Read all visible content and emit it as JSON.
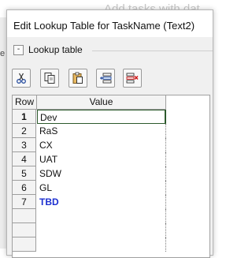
{
  "background": {
    "top_text": "Add tasks with dat",
    "left_fragment": "e"
  },
  "dialog": {
    "title": "Edit Lookup Table for TaskName (Text2)",
    "section": {
      "toggle": "-",
      "label": "Lookup table"
    }
  },
  "toolbar": {
    "buttons": [
      {
        "icon": "cut-icon"
      },
      {
        "icon": "copy-icon"
      },
      {
        "icon": "paste-icon"
      },
      {
        "icon": "insert-row-icon"
      },
      {
        "icon": "delete-row-icon"
      }
    ]
  },
  "table": {
    "headers": {
      "row": "Row",
      "value": "Value"
    },
    "rows": [
      {
        "num": "1",
        "value": "Dev"
      },
      {
        "num": "2",
        "value": "RaS"
      },
      {
        "num": "3",
        "value": "CX"
      },
      {
        "num": "4",
        "value": "UAT"
      },
      {
        "num": "5",
        "value": "SDW"
      },
      {
        "num": "6",
        "value": "GL"
      },
      {
        "num": "7",
        "value": "TBD"
      },
      {
        "num": "",
        "value": ""
      },
      {
        "num": "",
        "value": ""
      },
      {
        "num": "",
        "value": ""
      }
    ]
  },
  "colors": {
    "tbd_text": "#1c2fd0",
    "selection_border": "#2d5a2d"
  }
}
